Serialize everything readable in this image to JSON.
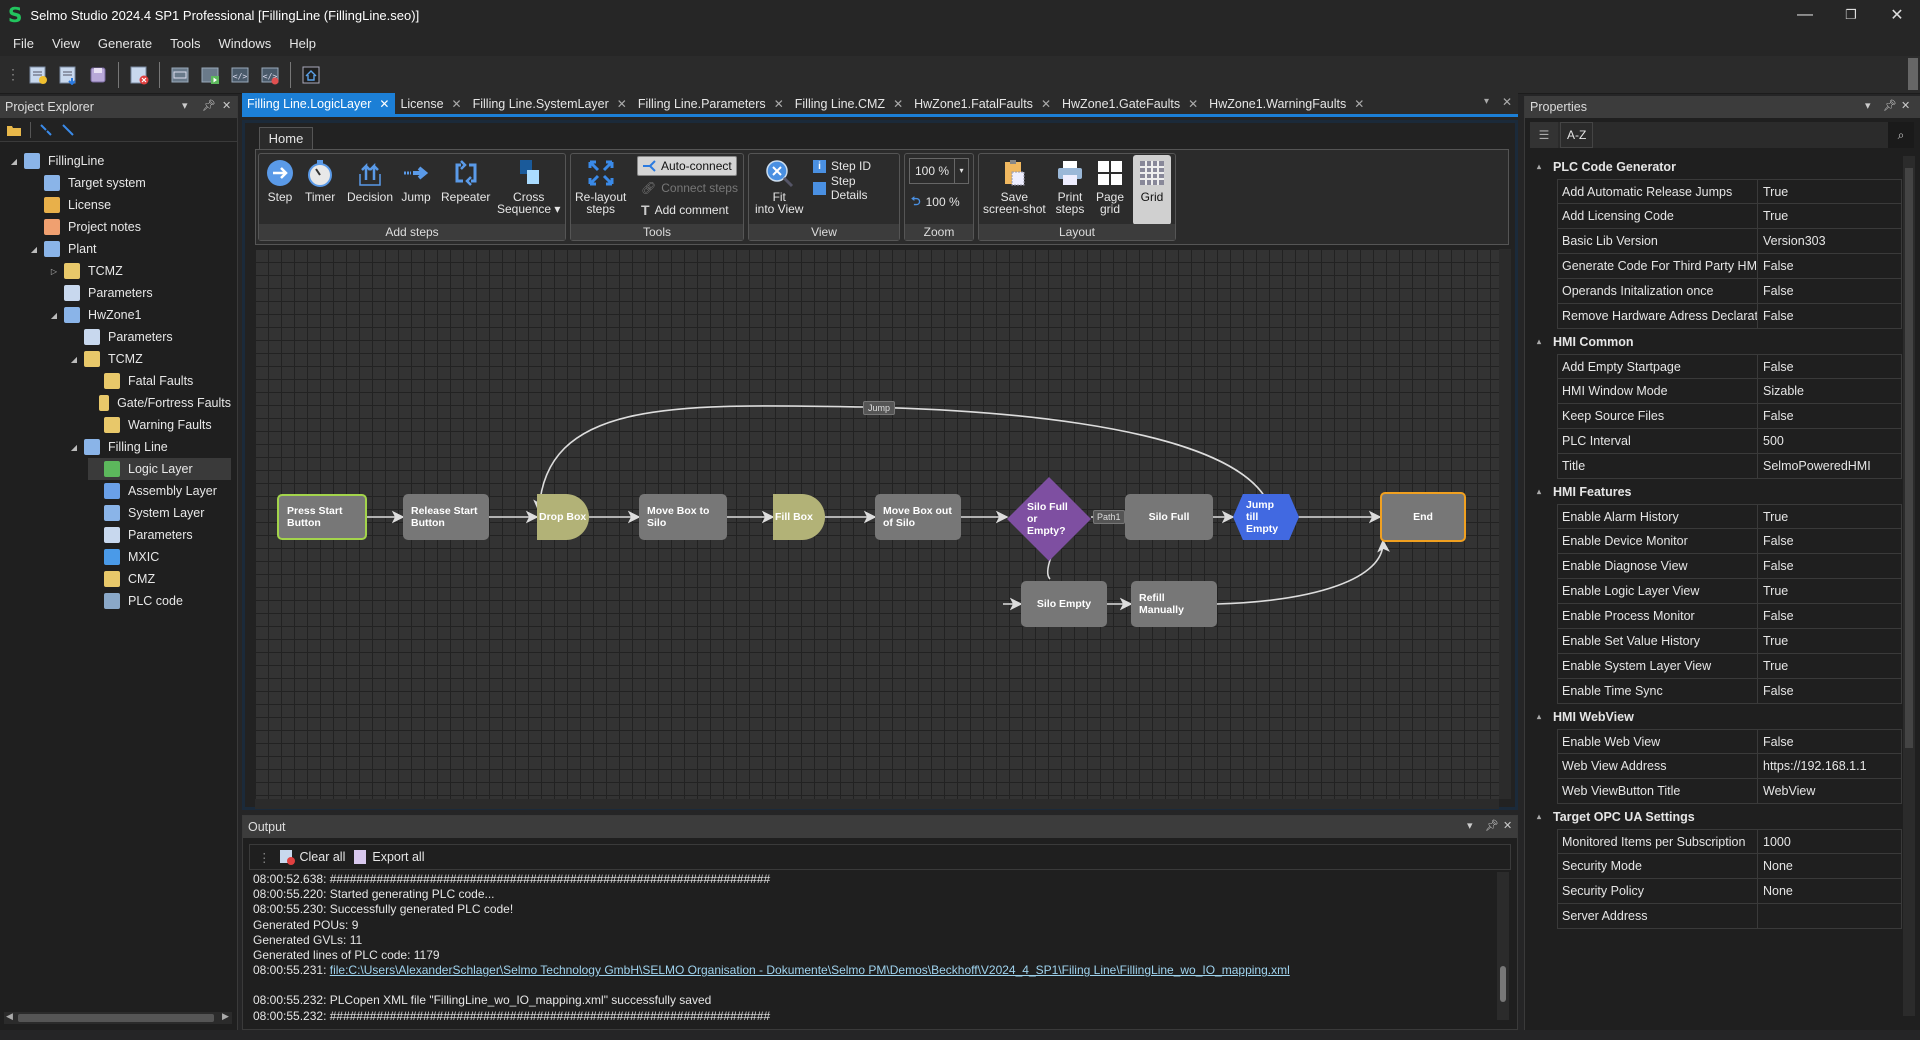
{
  "app": {
    "title": "Selmo Studio 2024.4 SP1 Professional  [FillingLine (FillingLine.seo)]",
    "logo_letter": "S",
    "window_controls": {
      "minimize": "—",
      "restore": "❐",
      "close": "✕"
    }
  },
  "menu": [
    "File",
    "View",
    "Generate",
    "Tools",
    "Windows",
    "Help"
  ],
  "toolbar": {
    "icons": [
      "new-project-icon",
      "open-project-icon",
      "save-icon",
      "close-project-icon",
      "layout-view-icon",
      "simulate-icon",
      "generate-code-icon",
      "delete-code-icon",
      "home-icon"
    ]
  },
  "explorer": {
    "title": "Project Explorer",
    "tree": [
      {
        "label": "FillingLine",
        "level": 0,
        "expander": "◢",
        "icon": "project-icon",
        "color": "#8ab4e8"
      },
      {
        "label": "Target system",
        "level": 1,
        "expander": "",
        "icon": "target-system-icon",
        "color": "#8ab4e8"
      },
      {
        "label": "License",
        "level": 1,
        "expander": "",
        "icon": "key-icon",
        "color": "#e8b04a"
      },
      {
        "label": "Project notes",
        "level": 1,
        "expander": "",
        "icon": "notes-icon",
        "color": "#f0a070"
      },
      {
        "label": "Plant",
        "level": 1,
        "expander": "◢",
        "icon": "plant-icon",
        "color": "#8ab4e8"
      },
      {
        "label": "TCMZ",
        "level": 2,
        "expander": "▷",
        "icon": "envelope-icon",
        "color": "#e8c86a"
      },
      {
        "label": "Parameters",
        "level": 2,
        "expander": "",
        "icon": "parameters-icon",
        "color": "#c8d8ee"
      },
      {
        "label": "HwZone1",
        "level": 2,
        "expander": "◢",
        "icon": "cube-icon",
        "color": "#8ab4e8"
      },
      {
        "label": "Parameters",
        "level": 3,
        "expander": "",
        "icon": "parameters-icon",
        "color": "#c8d8ee"
      },
      {
        "label": "TCMZ",
        "level": 3,
        "expander": "◢",
        "icon": "envelope-icon",
        "color": "#e8c86a"
      },
      {
        "label": "Fatal Faults",
        "level": 4,
        "expander": "",
        "icon": "fatal-faults-icon",
        "color": "#e8c86a"
      },
      {
        "label": "Gate/Fortress Faults",
        "level": 4,
        "expander": "",
        "icon": "gate-faults-icon",
        "color": "#e8c86a"
      },
      {
        "label": "Warning Faults",
        "level": 4,
        "expander": "",
        "icon": "warning-faults-icon",
        "color": "#e8c86a"
      },
      {
        "label": "Filling Line",
        "level": 3,
        "expander": "◢",
        "icon": "cube-icon",
        "color": "#8ab4e8"
      },
      {
        "label": "Logic Layer",
        "level": 4,
        "expander": "",
        "icon": "logic-layer-icon",
        "color": "#5cb85c",
        "selected": true
      },
      {
        "label": "Assembly Layer",
        "level": 4,
        "expander": "",
        "icon": "assembly-layer-icon",
        "color": "#6aa0e8"
      },
      {
        "label": "System Layer",
        "level": 4,
        "expander": "",
        "icon": "system-layer-icon",
        "color": "#8ab4e8"
      },
      {
        "label": "Parameters",
        "level": 4,
        "expander": "",
        "icon": "parameters-icon",
        "color": "#c8d8ee"
      },
      {
        "label": "MXIC",
        "level": 4,
        "expander": "",
        "icon": "mxic-icon",
        "color": "#4a9ae8"
      },
      {
        "label": "CMZ",
        "level": 4,
        "expander": "",
        "icon": "envelope-icon",
        "color": "#e8c86a"
      },
      {
        "label": "PLC code",
        "level": 4,
        "expander": "",
        "icon": "code-icon",
        "color": "#8aa8c8"
      }
    ]
  },
  "doc_tabs": [
    {
      "label": "Filling Line.LogicLayer",
      "active": true
    },
    {
      "label": "License"
    },
    {
      "label": "Filling Line.SystemLayer"
    },
    {
      "label": "Filling Line.Parameters"
    },
    {
      "label": "Filling Line.CMZ"
    },
    {
      "label": "HwZone1.FatalFaults"
    },
    {
      "label": "HwZone1.GateFaults"
    },
    {
      "label": "HwZone1.WarningFaults"
    }
  ],
  "ribbon": {
    "tab": "Home",
    "groups": {
      "add_steps": {
        "label": "Add steps",
        "buttons": [
          "Step",
          "Timer",
          "Decision",
          "Jump",
          "Repeater"
        ],
        "cross_line1": "Cross",
        "cross_line2": "Sequence ▾"
      },
      "tools": {
        "label": "Tools",
        "relayout1": "Re-layout",
        "relayout2": "steps",
        "auto_connect": "Auto-connect",
        "connect_steps": "Connect steps",
        "add_comment": "Add comment"
      },
      "view": {
        "label": "View",
        "fit1": "Fit",
        "fit2": "into View",
        "step_id": "Step ID",
        "step_details": "Step Details"
      },
      "zoom": {
        "label": "Zoom",
        "value": "100 %",
        "reset": "100 %"
      },
      "layout": {
        "label": "Layout",
        "save1": "Save",
        "save2": "screen-shot",
        "print1": "Print",
        "print2": "steps",
        "page1": "Page",
        "page2": "grid",
        "grid": "Grid"
      }
    }
  },
  "diagram": {
    "nodes": [
      {
        "id": "press_start",
        "label": "Press Start Button",
        "type": "start",
        "fill": "#777777",
        "border": "#a3d44b"
      },
      {
        "id": "release_start",
        "label": "Release Start Button",
        "type": "step",
        "fill": "#777777"
      },
      {
        "id": "drop_box",
        "label": "Drop Box",
        "type": "timer",
        "fill": "#b2b277"
      },
      {
        "id": "move_to_silo",
        "label": "Move Box to Silo",
        "type": "step",
        "fill": "#777777"
      },
      {
        "id": "fill_box",
        "label": "Fill Box",
        "type": "timer",
        "fill": "#b2b277"
      },
      {
        "id": "move_out",
        "label": "Move Box out of Silo",
        "type": "step",
        "fill": "#777777"
      },
      {
        "id": "decision",
        "label": "Silo Full or Empty?",
        "type": "decision",
        "fill": "#7e4fa1"
      },
      {
        "id": "silo_full",
        "label": "Silo Full",
        "type": "step",
        "fill": "#777777"
      },
      {
        "id": "jump_till_empty",
        "label": "Jump till Empty",
        "type": "jump",
        "fill": "#4169e1"
      },
      {
        "id": "end",
        "label": "End",
        "type": "end",
        "fill": "#777777",
        "border": "#f0a020"
      },
      {
        "id": "silo_empty",
        "label": "Silo Empty",
        "type": "step",
        "fill": "#777777"
      },
      {
        "id": "refill",
        "label": "Refill Manually",
        "type": "step",
        "fill": "#777777"
      }
    ],
    "edge_labels": {
      "jump": "Jump",
      "path1": "Path1"
    }
  },
  "output": {
    "title": "Output",
    "clear_all": "Clear all",
    "export_all": "Export all",
    "lines": [
      "08:00:52.638: ##################################################################",
      "08:00:55.220: Started generating PLC code...",
      "08:00:55.230: Successfully generated PLC code!",
      "Generated POUs: 9",
      "Generated GVLs: 11",
      "Generated lines of PLC code: 1179"
    ],
    "link_prefix": "08:00:55.231: ",
    "link": "file:C:\\Users\\AlexanderSchlager\\Selmo Technology GmbH\\SELMO Organisation - Dokumente\\Selmo PM\\Demos\\Beckhoff\\V2024_4_SP1\\Filing Line\\FillingLine_wo_IO_mapping.xml",
    "after": [
      "",
      "08:00:55.232: PLCopen XML file \"FillingLine_wo_IO_mapping.xml\" successfully saved",
      "08:00:55.232: ##################################################################"
    ]
  },
  "properties": {
    "title": "Properties",
    "sort_label": "A-Z",
    "categories": [
      {
        "name": "PLC Code Generator",
        "rows": [
          [
            "Add Automatic Release Jumps",
            "True"
          ],
          [
            "Add Licensing Code",
            "True"
          ],
          [
            "Basic Lib Version",
            "Version303"
          ],
          [
            "Generate Code For Third Party HMI",
            "False"
          ],
          [
            "Operands Initalization once",
            "False"
          ],
          [
            "Remove Hardware Adress Declaration",
            "False"
          ]
        ]
      },
      {
        "name": "HMI Common",
        "rows": [
          [
            "Add Empty Startpage",
            "False"
          ],
          [
            "HMI Window Mode",
            "Sizable"
          ],
          [
            "Keep Source Files",
            "False"
          ],
          [
            "PLC Interval",
            "500"
          ],
          [
            "Title",
            "SelmoPoweredHMI"
          ]
        ]
      },
      {
        "name": "HMI Features",
        "rows": [
          [
            "Enable Alarm History",
            "True"
          ],
          [
            "Enable Device Monitor",
            "False"
          ],
          [
            "Enable Diagnose View",
            "False"
          ],
          [
            "Enable Logic Layer View",
            "True"
          ],
          [
            "Enable Process Monitor",
            "False"
          ],
          [
            "Enable Set Value History",
            "True"
          ],
          [
            "Enable System Layer View",
            "True"
          ],
          [
            "Enable Time Sync",
            "False"
          ]
        ]
      },
      {
        "name": "HMI WebView",
        "rows": [
          [
            "Enable Web View",
            "False"
          ],
          [
            "Web View Address",
            "https://192.168.1.1"
          ],
          [
            "Web ViewButton Title",
            "WebView"
          ]
        ]
      },
      {
        "name": "Target OPC UA Settings",
        "rows": [
          [
            "Monitored Items per Subscription",
            "1000"
          ],
          [
            "Security Mode",
            "None"
          ],
          [
            "Security Policy",
            "None"
          ],
          [
            "Server Address",
            ""
          ]
        ]
      }
    ]
  }
}
